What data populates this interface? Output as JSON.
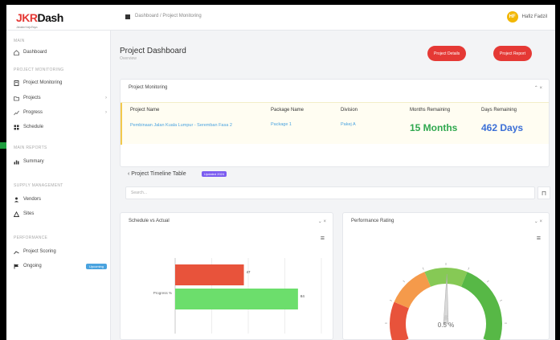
{
  "header": {
    "logo_main": "JKR",
    "logo_accent": "Dash",
    "logo_tagline": "Jabatan Kerja Raya",
    "breadcrumb": "Dashboard / Project Monitoring",
    "user_initials": "HF",
    "user_name": "Hafiz Fadzil"
  },
  "sidebar": {
    "sections": [
      {
        "label": "MAIN"
      },
      {
        "label": "PROJECT MONITORING"
      },
      {
        "label": "MAIN REPORTS"
      },
      {
        "label": "SUPPLY MANAGEMENT"
      },
      {
        "label": "PERFORMANCE"
      }
    ],
    "items": [
      {
        "label": "Dashboard",
        "icon": "home-icon"
      },
      {
        "label": "Project Monitoring",
        "icon": "clipboard-icon"
      },
      {
        "label": "Projects",
        "icon": "folder-icon",
        "chevron": "›"
      },
      {
        "label": "Progress",
        "icon": "chart-icon",
        "chevron": "›"
      },
      {
        "label": "Schedule",
        "icon": "grid-icon"
      },
      {
        "label": "Summary",
        "icon": "bar-icon"
      },
      {
        "label": "Vendors",
        "icon": "user-icon"
      },
      {
        "label": "Sites",
        "icon": "site-icon"
      },
      {
        "label": "Project Scoring",
        "icon": "score-icon"
      },
      {
        "label": "Ongoing",
        "icon": "flag-icon",
        "badge": "Upcoming"
      }
    ]
  },
  "main": {
    "title": "Project Dashboard",
    "subtitle": "Overview",
    "btn_primary": "Project Details",
    "btn_secondary": "Project Report",
    "project_monitoring": {
      "title": "Project Monitoring",
      "controls": "⌃ ×",
      "columns": [
        {
          "header": "Project Name",
          "value": "Pembinaan Jalan Kuala Lumpur - Seremban Fasa 2"
        },
        {
          "header": "Package Name",
          "value": "Package 1"
        },
        {
          "header": "Division",
          "value": "Pakej A"
        },
        {
          "header": "Months Remaining",
          "value": "15 Months"
        },
        {
          "header": "Days Remaining",
          "value": "462 Days"
        }
      ]
    },
    "timeline": {
      "label": "Project Timeline Table",
      "badge": "Updated 2024"
    },
    "search": {
      "placeholder": "Search...",
      "button": "⊓"
    },
    "schedule_card": {
      "title": "Schedule vs Actual",
      "controls": "⌄ ×",
      "menu": "≡"
    },
    "performance_card": {
      "title": "Performance Rating",
      "controls": "⌄ ×",
      "menu": "≡"
    }
  },
  "chart_data": [
    {
      "type": "bar",
      "orientation": "horizontal",
      "title": "Schedule vs Actual",
      "categories": [
        "Progress %"
      ],
      "series": [
        {
          "name": "Schedule",
          "values": [
            47
          ],
          "color": "#e8533b"
        },
        {
          "name": "Actual",
          "values": [
            84
          ],
          "color": "#6cde6c"
        }
      ],
      "xlim": [
        0,
        100
      ]
    },
    {
      "type": "gauge",
      "title": "Performance Rating",
      "value": 0.5,
      "value_label": "0.5 %",
      "min": 0,
      "max": 100,
      "bands": [
        {
          "from": 0,
          "to": 20,
          "color": "#e8533b"
        },
        {
          "from": 20,
          "to": 40,
          "color": "#f59a4b"
        },
        {
          "from": 40,
          "to": 60,
          "color": "#86c955"
        },
        {
          "from": 60,
          "to": 100,
          "color": "#57b846"
        }
      ]
    }
  ],
  "colors": {
    "accent": "#e53935",
    "link": "#4aa3df",
    "success": "#2fa84f",
    "info": "#3b6fd6"
  }
}
